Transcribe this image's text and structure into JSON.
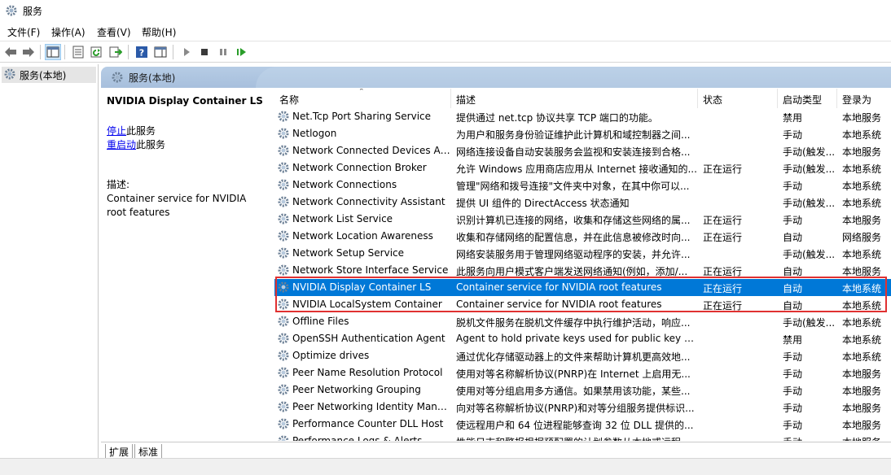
{
  "window": {
    "title": "服务"
  },
  "menu": {
    "items": [
      "文件(F)",
      "操作(A)",
      "查看(V)",
      "帮助(H)"
    ]
  },
  "tree": {
    "item_label": "服务(本地)"
  },
  "pane_header": {
    "label": "服务(本地)"
  },
  "desc_pane": {
    "selected_service": "NVIDIA Display Container LS",
    "stop_link": "停止",
    "stop_suffix": "此服务",
    "restart_link": "重启动",
    "restart_suffix": "此服务",
    "desc_label": "描述:",
    "desc_text": "Container service for NVIDIA root features"
  },
  "columns": {
    "name": "名称",
    "desc": "描述",
    "status": "状态",
    "startup": "启动类型",
    "logon": "登录为"
  },
  "services": [
    {
      "name": "Net.Tcp Port Sharing Service",
      "desc": "提供通过 net.tcp 协议共享 TCP 端口的功能。",
      "status": "",
      "startup": "禁用",
      "logon": "本地服务"
    },
    {
      "name": "Netlogon",
      "desc": "为用户和服务身份验证维护此计算机和域控制器之间...",
      "status": "",
      "startup": "手动",
      "logon": "本地系统"
    },
    {
      "name": "Network Connected Devices Au...",
      "desc": "网络连接设备自动安装服务会监视和安装连接到合格...",
      "status": "",
      "startup": "手动(触发...",
      "logon": "本地服务"
    },
    {
      "name": "Network Connection Broker",
      "desc": "允许 Windows 应用商店应用从 Internet 接收通知的...",
      "status": "正在运行",
      "startup": "手动(触发...",
      "logon": "本地系统"
    },
    {
      "name": "Network Connections",
      "desc": "管理\"网络和拨号连接\"文件夹中对象，在其中你可以...",
      "status": "",
      "startup": "手动",
      "logon": "本地系统"
    },
    {
      "name": "Network Connectivity Assistant",
      "desc": "提供 UI 组件的 DirectAccess 状态通知",
      "status": "",
      "startup": "手动(触发...",
      "logon": "本地系统"
    },
    {
      "name": "Network List Service",
      "desc": "识别计算机已连接的网络，收集和存储这些网络的属...",
      "status": "正在运行",
      "startup": "手动",
      "logon": "本地服务"
    },
    {
      "name": "Network Location Awareness",
      "desc": "收集和存储网络的配置信息，并在此信息被修改时向...",
      "status": "正在运行",
      "startup": "自动",
      "logon": "网络服务"
    },
    {
      "name": "Network Setup Service",
      "desc": "网络安装服务用于管理网络驱动程序的安装，并允许...",
      "status": "",
      "startup": "手动(触发...",
      "logon": "本地系统"
    },
    {
      "name": "Network Store Interface Service",
      "desc": "此服务向用户模式客户端发送网络通知(例如，添加/...",
      "status": "正在运行",
      "startup": "自动",
      "logon": "本地服务"
    },
    {
      "name": "NVIDIA Display Container LS",
      "desc": "Container service for NVIDIA root features",
      "status": "正在运行",
      "startup": "自动",
      "logon": "本地系统"
    },
    {
      "name": "NVIDIA LocalSystem Container",
      "desc": "Container service for NVIDIA root features",
      "status": "正在运行",
      "startup": "自动",
      "logon": "本地系统"
    },
    {
      "name": "Offline Files",
      "desc": "脱机文件服务在脱机文件缓存中执行维护活动，响应...",
      "status": "",
      "startup": "手动(触发...",
      "logon": "本地系统"
    },
    {
      "name": "OpenSSH Authentication Agent",
      "desc": "Agent to hold private keys used for public key a...",
      "status": "",
      "startup": "禁用",
      "logon": "本地系统"
    },
    {
      "name": "Optimize drives",
      "desc": "通过优化存储驱动器上的文件来帮助计算机更高效地...",
      "status": "",
      "startup": "手动",
      "logon": "本地系统"
    },
    {
      "name": "Peer Name Resolution Protocol",
      "desc": "使用对等名称解析协议(PNRP)在 Internet 上启用无...",
      "status": "",
      "startup": "手动",
      "logon": "本地服务"
    },
    {
      "name": "Peer Networking Grouping",
      "desc": "使用对等分组启用多方通信。如果禁用该功能，某些...",
      "status": "",
      "startup": "手动",
      "logon": "本地服务"
    },
    {
      "name": "Peer Networking Identity Mana...",
      "desc": "向对等名称解析协议(PNRP)和对等分组服务提供标识...",
      "status": "",
      "startup": "手动",
      "logon": "本地服务"
    },
    {
      "name": "Performance Counter DLL Host",
      "desc": "使远程用户和 64 位进程能够查询 32 位 DLL 提供的...",
      "status": "",
      "startup": "手动",
      "logon": "本地服务"
    },
    {
      "name": "Performance Logs & Alerts",
      "desc": "性能日志和警报根据预配置的计划参数从本地或远程...",
      "status": "",
      "startup": "手动",
      "logon": "本地服务"
    }
  ],
  "tabs": [
    "扩展",
    "标准"
  ],
  "colors": {
    "selection": "#0078d7",
    "highlight_border": "#e03131",
    "header_bg": "#b6cce5"
  }
}
